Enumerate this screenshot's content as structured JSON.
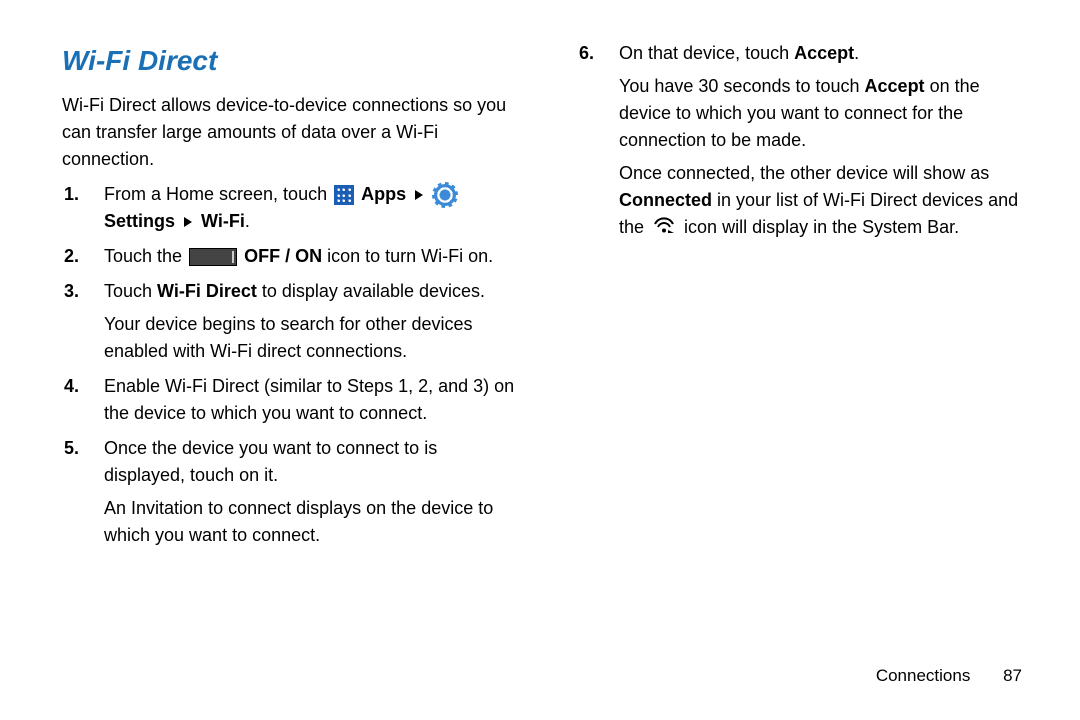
{
  "title": "Wi-Fi Direct",
  "intro": "Wi-Fi Direct allows device-to-device connections so you can transfer large amounts of data over a Wi-Fi connection.",
  "step1": {
    "a": "From a Home screen, touch ",
    "apps": "Apps",
    "settings": "Settings",
    "wifi": "Wi-Fi",
    "end": "."
  },
  "step2": {
    "a": "Touch the ",
    "b": "OFF / ON",
    "c": " icon to turn Wi-Fi on."
  },
  "step3": {
    "a": "Touch ",
    "b": "Wi-Fi Direct",
    "c": " to display available devices.",
    "d": "Your device begins to search for other devices enabled with Wi-Fi direct connections."
  },
  "step4": "Enable Wi-Fi Direct (similar to Steps 1, 2, and 3) on the device to which you want to connect.",
  "step5": {
    "a": "Once the device you want to connect to is displayed, touch on it.",
    "b": "An Invitation to connect displays on the device to which you want to connect."
  },
  "step6": {
    "a": "On that device, touch ",
    "b": "Accept",
    "c": ".",
    "d1": "You have 30 seconds to touch ",
    "d2": "Accept",
    "d3": " on the device to which you want to connect for the connection to be made.",
    "e1": "Once connected, the other device will show as ",
    "e2": "Connected",
    "e3": " in your list of Wi-Fi Direct devices and the ",
    "e4": " icon will display in the System Bar."
  },
  "footer": {
    "section": "Connections",
    "page": "87"
  }
}
